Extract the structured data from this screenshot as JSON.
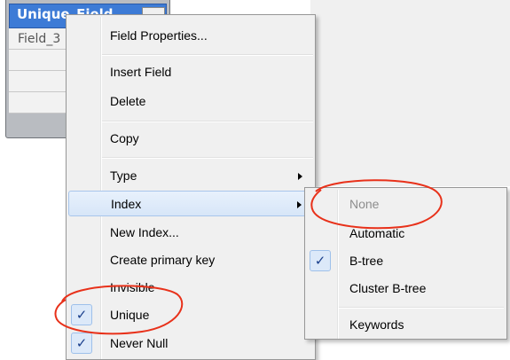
{
  "table": {
    "header_label": "Unique_Field",
    "row_label": "Field_3"
  },
  "context_menu": {
    "items": [
      {
        "label": "Field Properties..."
      },
      {
        "label": "Insert Field"
      },
      {
        "label": "Delete"
      },
      {
        "label": "Copy"
      },
      {
        "label": "Type"
      },
      {
        "label": "Index"
      },
      {
        "label": "New Index..."
      },
      {
        "label": "Create primary key"
      },
      {
        "label": "Invisible"
      },
      {
        "label": "Unique",
        "checked": true
      },
      {
        "label": "Never Null",
        "checked": true
      }
    ]
  },
  "index_submenu": {
    "items": [
      {
        "label": "None",
        "disabled": true
      },
      {
        "label": "Automatic"
      },
      {
        "label": "B-tree",
        "checked": true
      },
      {
        "label": "Cluster B-tree"
      },
      {
        "label": "Keywords"
      }
    ]
  },
  "glyphs": {
    "check": "✓"
  },
  "colors": {
    "annotation": "#e8311a",
    "highlight": "#d7e6f8",
    "header": "#3d7bd6"
  }
}
